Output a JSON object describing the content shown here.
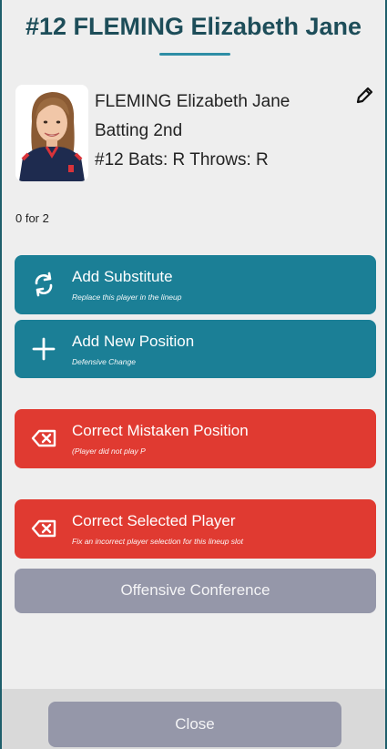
{
  "header": {
    "title": "#12 FLEMING Elizabeth Jane"
  },
  "player": {
    "name": "FLEMING Elizabeth Jane",
    "batting_order": "Batting 2nd",
    "details": "#12 Bats: R Throws: R",
    "stat_line": "0 for 2"
  },
  "actions": {
    "add_substitute": {
      "label": "Add Substitute",
      "sub": "Replace this player in the lineup"
    },
    "add_position": {
      "label": "Add New Position",
      "sub": "Defensive Change"
    },
    "correct_position": {
      "label": "Correct Mistaken Position",
      "sub": "(Player did not play P"
    },
    "correct_player": {
      "label": "Correct Selected Player",
      "sub": "Fix an incorrect player selection for this lineup slot"
    },
    "offensive_conference": {
      "label": "Offensive Conference"
    }
  },
  "footer": {
    "close_label": "Close"
  },
  "colors": {
    "title": "#1d4d59",
    "accent_blue": "#1b7f96",
    "danger_red": "#e03a31",
    "neutral_gray": "#9597a9"
  },
  "icons": {
    "edit": "pencil-icon",
    "substitute": "refresh-icon",
    "add": "plus-icon",
    "clear": "backspace-x-icon"
  }
}
